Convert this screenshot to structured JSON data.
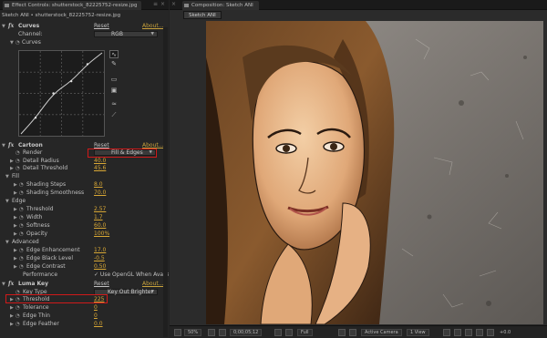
{
  "effect_controls": {
    "tab_title": "Effect Controls: shutterstock_82225752-resize.jpg",
    "close": "×",
    "menu": "≡",
    "layer_path": "Sketch ANI • shutterstock_82225752-resize.jpg",
    "curves": {
      "name": "Curves",
      "reset": "Reset",
      "about": "About...",
      "channel_label": "Channel:",
      "channel_value": "RGB",
      "curves_label": "Curves",
      "curve_points": [
        [
          0,
          0
        ],
        [
          0.18,
          0.2
        ],
        [
          0.4,
          0.5
        ],
        [
          0.62,
          0.65
        ],
        [
          0.82,
          0.86
        ],
        [
          1,
          1
        ]
      ],
      "tools": [
        "curve-tool-icon",
        "pencil-tool-icon",
        "open-file-icon",
        "save-file-icon",
        "smooth-icon",
        "reset-curve-icon"
      ]
    },
    "cartoon": {
      "name": "Cartoon",
      "reset": "Reset",
      "about": "About...",
      "render_label": "Render",
      "render_value": "Fill & Edges",
      "detail_radius_label": "Detail Radius",
      "detail_radius_value": "40.0",
      "detail_threshold_label": "Detail Threshold",
      "detail_threshold_value": "45.6",
      "fill_label": "Fill",
      "shading_steps_label": "Shading Steps",
      "shading_steps_value": "8.0",
      "shading_smoothness_label": "Shading Smoothness",
      "shading_smoothness_value": "70.0",
      "edge_label": "Edge",
      "threshold_label": "Threshold",
      "threshold_value": "2.57",
      "width_label": "Width",
      "width_value": "1.7",
      "softness_label": "Softness",
      "softness_value": "60.0",
      "opacity_label": "Opacity",
      "opacity_value": "100%",
      "advanced_label": "Advanced",
      "edge_enhancement_label": "Edge Enhancement",
      "edge_enhancement_value": "17.0",
      "edge_black_level_label": "Edge Black Level",
      "edge_black_level_value": "-0.5",
      "edge_contrast_label": "Edge Contrast",
      "edge_contrast_value": "0.50",
      "performance_label": "Performance",
      "performance_value": "✓ Use OpenGL When Availa"
    },
    "luma_key": {
      "name": "Luma Key",
      "reset": "Reset",
      "about": "About...",
      "key_type_label": "Key Type",
      "key_type_value": "Key Out Brighter",
      "threshold_label": "Threshold",
      "threshold_value": "225",
      "tolerance_label": "Tolerance",
      "tolerance_value": "0",
      "edge_thin_label": "Edge Thin",
      "edge_thin_value": "0",
      "edge_feather_label": "Edge Feather",
      "edge_feather_value": "0.0"
    }
  },
  "composition": {
    "tab_title": "Composition: Sketch ANI",
    "close": "×",
    "sub_tab": "Sketch ANI",
    "bottom": {
      "zoom": "50%",
      "timecode": "0;00;05;12",
      "resolution": "Full",
      "camera": "Active Camera",
      "view": "1 View",
      "exposure": "+0.0"
    }
  },
  "colors": {
    "value": "#d8a735",
    "highlight": "#d01a1a",
    "panel": "#262626"
  }
}
